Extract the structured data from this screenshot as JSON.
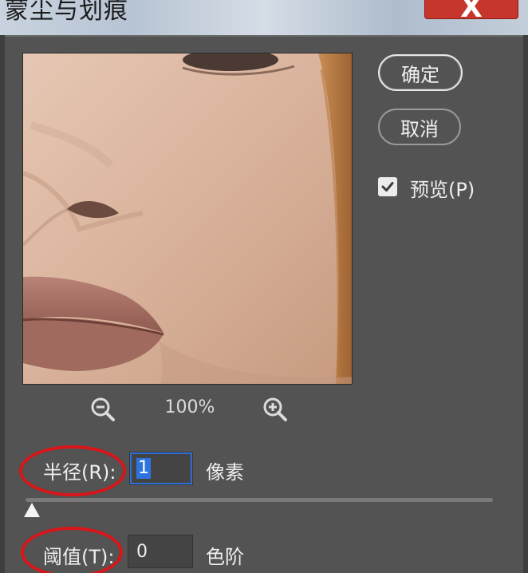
{
  "window": {
    "title": "蒙尘与划痕",
    "close_label": "X"
  },
  "buttons": {
    "ok": "确定",
    "cancel": "取消"
  },
  "preview_option": {
    "label": "预览(P)",
    "checked": true
  },
  "zoom": {
    "level": "100%",
    "zoom_out_icon": "zoom-out-icon",
    "zoom_in_icon": "zoom-in-icon"
  },
  "radius": {
    "label": "半径(R):",
    "value": "1",
    "unit": "像素"
  },
  "threshold": {
    "label": "阈值(T):",
    "value": "0",
    "unit": "色阶"
  },
  "colors": {
    "dialog_bg": "#535353",
    "accent_selection": "#2f74dc",
    "annotation": "#d8161a",
    "close_button": "#c7362c"
  }
}
